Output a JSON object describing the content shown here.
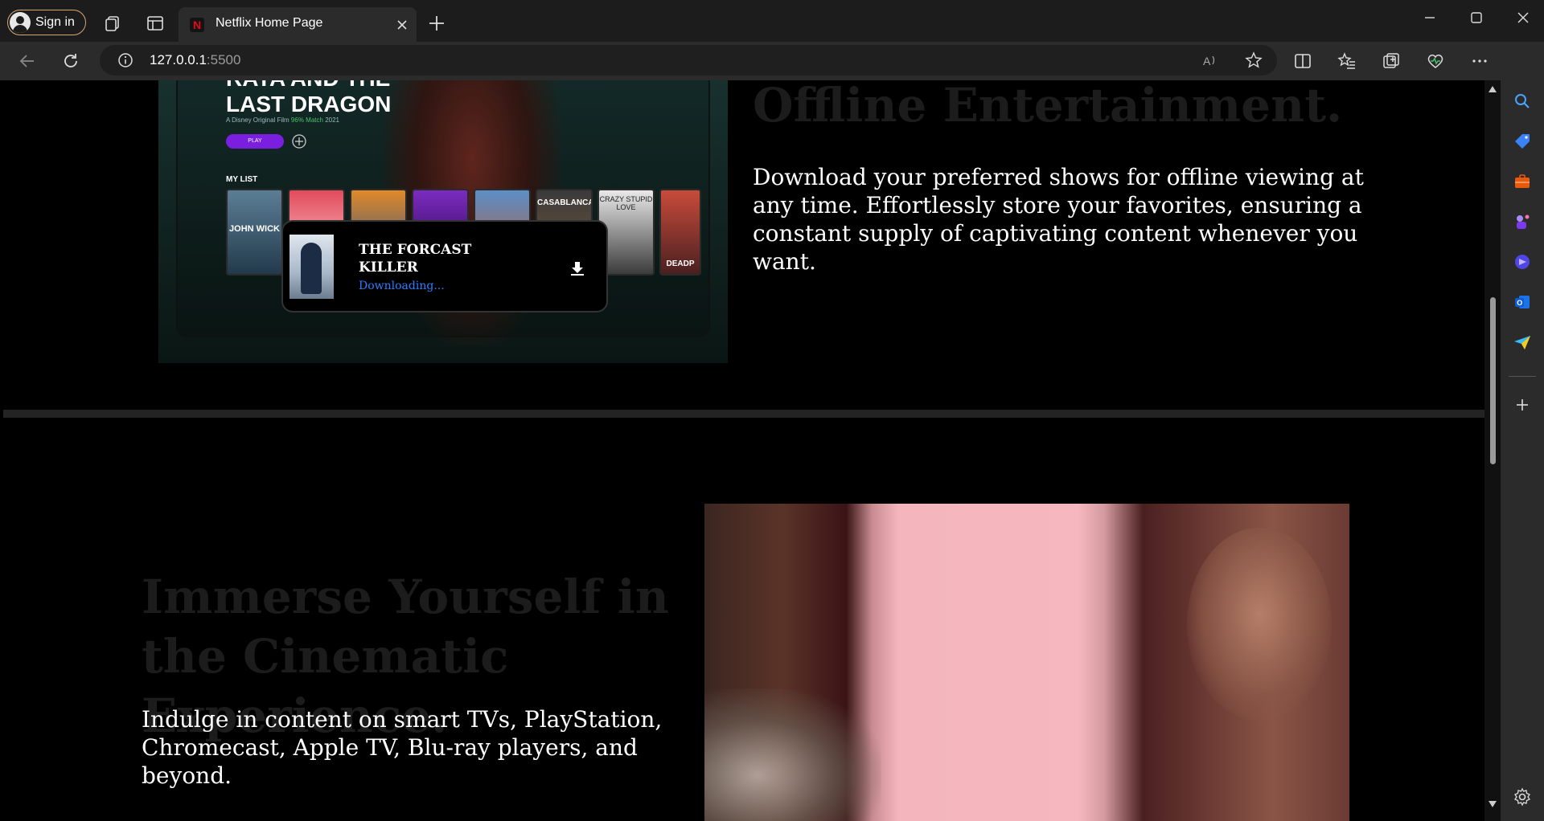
{
  "browser": {
    "signin_label": "Sign in",
    "tab_title": "Netflix Home Page",
    "tab_favicon": "N",
    "url_host": "127.0.0.1",
    "url_port": ":5500"
  },
  "section1": {
    "heading": "Offline Entertainment.",
    "body": "Download your preferred shows for offline viewing at any time. Effortlessly store your favorites, ensuring a constant supply of captivating content whenever you want.",
    "mockup": {
      "movie_title": "RAYA AND THE LAST DRAGON",
      "meta_prefix": "A Disney Original Film",
      "meta_match": "96% Match",
      "meta_year": "2021",
      "play_label": "PLAY",
      "mylist_label": "MY LIST",
      "posters": [
        "JOHN WICK",
        "",
        "",
        "",
        "",
        "CASABLANCA",
        "CRAZY STUPID LOVE",
        "DEADP"
      ]
    },
    "download_card": {
      "title": "THE FORCAST KILLER",
      "status": "Downloading..."
    }
  },
  "section2": {
    "heading": "Immerse Yourself in the Cinematic Experience.",
    "body": "Indulge in content on smart TVs, PlayStation, Chromecast, Apple TV, Blu-ray players, and beyond."
  },
  "colors": {
    "accent_download": "#2f7cff",
    "play_button": "#7a1fe0",
    "netflix_red": "#e50914"
  }
}
